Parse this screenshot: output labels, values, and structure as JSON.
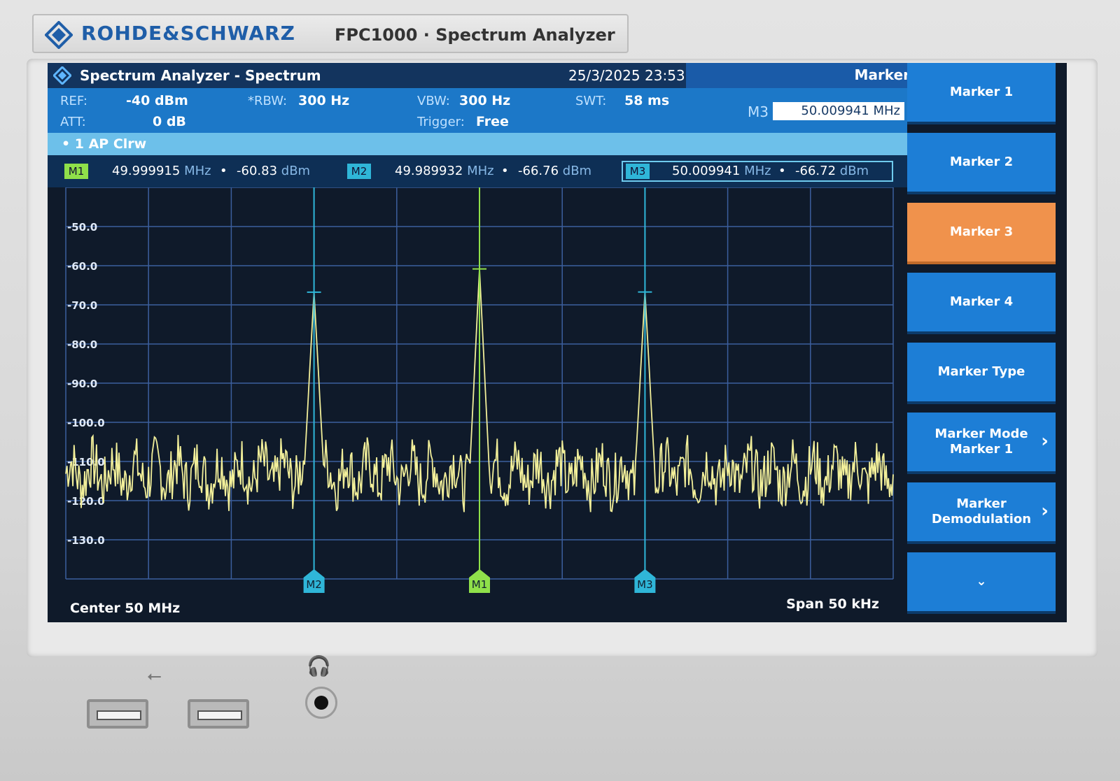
{
  "device": {
    "brand": "ROHDE&SCHWARZ",
    "model": "FPC1000 · Spectrum Analyzer",
    "logo_icon": "rs-diamond-logo"
  },
  "screen": {
    "title": "Spectrum Analyzer - Spectrum",
    "date": "25/3/2025",
    "time": "23:53",
    "panel_title": "Marker",
    "params": {
      "ref_label": "REF:",
      "ref_value": "-40 dBm",
      "att_label": "ATT:",
      "att_value": "0 dB",
      "rbw_label": "*RBW:",
      "rbw_value": "300 Hz",
      "vbw_label": "VBW:",
      "vbw_value": "300 Hz",
      "trigger_label": "Trigger:",
      "trigger_value": "Free",
      "swt_label": "SWT:",
      "swt_value": "58 ms"
    },
    "marker_entry": {
      "label": "M3",
      "value": "50.009941 MHz"
    },
    "trace_info": "• 1 AP Clrw",
    "markers": [
      {
        "tag": "M1",
        "freq": "49.999915",
        "freq_unit": "MHz",
        "level": "-60.83",
        "level_unit": "dBm",
        "color": "#8fe04a"
      },
      {
        "tag": "M2",
        "freq": "49.989932",
        "freq_unit": "MHz",
        "level": "-66.76",
        "level_unit": "dBm",
        "color": "#2fb6d8"
      },
      {
        "tag": "M3",
        "freq": "50.009941",
        "freq_unit": "MHz",
        "level": "-66.72",
        "level_unit": "dBm",
        "color": "#2fb6d8"
      }
    ],
    "center_label": "Center 50 MHz",
    "span_label": "Span 50 kHz",
    "softkeys": [
      {
        "label": "Marker 1",
        "active": false
      },
      {
        "label": "Marker 2",
        "active": false
      },
      {
        "label": "Marker 3",
        "active": true
      },
      {
        "label": "Marker 4",
        "active": false
      },
      {
        "label": "Marker Type",
        "active": false
      },
      {
        "label": "Marker Mode\nMarker 1",
        "active": false,
        "chevron": "›"
      },
      {
        "label": "Marker\nDemodulation",
        "active": false,
        "chevron": "›"
      },
      {
        "label": "⌄",
        "active": false
      }
    ]
  },
  "chart_data": {
    "type": "line",
    "y_ticks": [
      "-50.0",
      "-60.0",
      "-70.0",
      "-80.0",
      "-90.0",
      "-100.0",
      "-110.0",
      "-120.0",
      "-130.0"
    ],
    "ylim": [
      -140,
      -40
    ],
    "xlim_khz": [
      -25,
      25
    ],
    "series": [
      {
        "color": "#f2ef9a",
        "noise_floor_dbm": -113,
        "peaks": [
          {
            "x_khz": -10.0,
            "y_dbm": -66.76,
            "marker": "M2"
          },
          {
            "x_khz": 0.0,
            "y_dbm": -60.83,
            "marker": "M1"
          },
          {
            "x_khz": 10.0,
            "y_dbm": -66.72,
            "marker": "M3"
          }
        ]
      }
    ],
    "grid": true
  }
}
